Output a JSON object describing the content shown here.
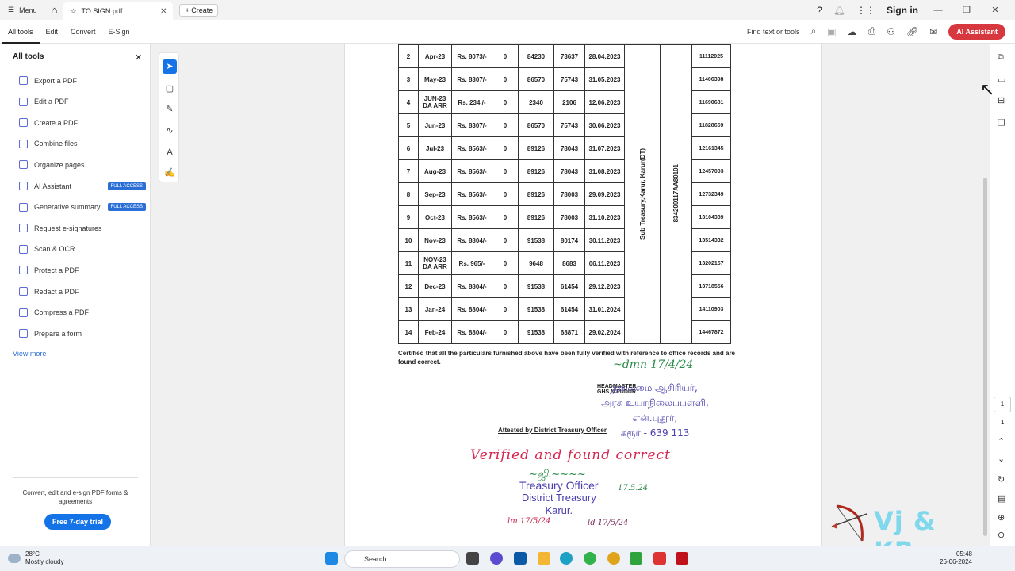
{
  "titlebar": {
    "menu_label": "Menu",
    "tab_title": "TO SIGN.pdf",
    "create_label": "Create",
    "sign_in": "Sign in"
  },
  "toolbar": {
    "tabs": [
      "All tools",
      "Edit",
      "Convert",
      "E-Sign"
    ],
    "find_label": "Find text or tools",
    "ai_assistant": "AI Assistant"
  },
  "left_panel": {
    "title": "All tools",
    "items": [
      {
        "label": "Export a PDF",
        "badge": ""
      },
      {
        "label": "Edit a PDF",
        "badge": ""
      },
      {
        "label": "Create a PDF",
        "badge": ""
      },
      {
        "label": "Combine files",
        "badge": ""
      },
      {
        "label": "Organize pages",
        "badge": ""
      },
      {
        "label": "AI Assistant",
        "badge": "FULL ACCESS"
      },
      {
        "label": "Generative summary",
        "badge": "FULL ACCESS"
      },
      {
        "label": "Request e-signatures",
        "badge": ""
      },
      {
        "label": "Scan & OCR",
        "badge": ""
      },
      {
        "label": "Protect a PDF",
        "badge": ""
      },
      {
        "label": "Redact a PDF",
        "badge": ""
      },
      {
        "label": "Compress a PDF",
        "badge": ""
      },
      {
        "label": "Prepare a form",
        "badge": ""
      }
    ],
    "view_more": "View more",
    "promo": "Convert, edit and e-sign PDF forms & agreements",
    "trial": "Free 7-day trial"
  },
  "document": {
    "rows": [
      [
        "2",
        "Apr-23",
        "Rs. 8073/-",
        "0",
        "84230",
        "73637",
        "28.04.2023",
        "11112025"
      ],
      [
        "3",
        "May-23",
        "Rs. 8307/-",
        "0",
        "86570",
        "75743",
        "31.05.2023",
        "11406398"
      ],
      [
        "4",
        "JUN-23 DA ARR",
        "Rs. 234 /-",
        "0",
        "2340",
        "2106",
        "12.06.2023",
        "11690681"
      ],
      [
        "5",
        "Jun-23",
        "Rs. 8307/-",
        "0",
        "86570",
        "75743",
        "30.06.2023",
        "11828659"
      ],
      [
        "6",
        "Jul-23",
        "Rs. 8563/-",
        "0",
        "89126",
        "78043",
        "31.07.2023",
        "12161345"
      ],
      [
        "7",
        "Aug-23",
        "Rs. 8563/-",
        "0",
        "89126",
        "78043",
        "31.08.2023",
        "12457003"
      ],
      [
        "8",
        "Sep-23",
        "Rs. 8563/-",
        "0",
        "89126",
        "78003",
        "29.09.2023",
        "12732349"
      ],
      [
        "9",
        "Oct-23",
        "Rs. 8563/-",
        "0",
        "89126",
        "78003",
        "31.10.2023",
        "13104389"
      ],
      [
        "10",
        "Nov-23",
        "Rs. 8804/-",
        "0",
        "91538",
        "80174",
        "30.11.2023",
        "13514332"
      ],
      [
        "11",
        "NOV-23 DA ARR",
        "Rs. 965/-",
        "0",
        "9648",
        "8683",
        "06.11.2023",
        "13202157"
      ],
      [
        "12",
        "Dec-23",
        "Rs. 8804/-",
        "0",
        "91538",
        "61454",
        "29.12.2023",
        "13718556"
      ],
      [
        "13",
        "Jan-24",
        "Rs. 8804/-",
        "0",
        "91538",
        "61454",
        "31.01.2024",
        "14110903"
      ],
      [
        "14",
        "Feb-24",
        "Rs. 8804/-",
        "0",
        "91538",
        "68871",
        "29.02.2024",
        "14467872"
      ]
    ],
    "treasury_vertical": "Sub Treasury,Karur, Karur(DT)",
    "account_vertical": "834200117AA80101",
    "certification": "Certified that all the particulars furnished above have been fully verified with reference to office records and are found correct.",
    "hm_line1": "HEADMASTER",
    "hm_line2": "GHS,N.PUDUR",
    "stamp_ta_1": "தலைமை ஆசிரியர்,",
    "stamp_ta_2": "அரசு உயர்நிலைப்பள்ளி,",
    "stamp_ta_3": "என்.புதூர்,",
    "stamp_ta_4": "கரூர் - 639 113",
    "attested": "Attested by District Treasury Officer",
    "verified_note": "Verified and found correct",
    "to_stamp_1": "Treasury Officer",
    "to_stamp_2": "District Treasury",
    "to_stamp_3": "Karur.",
    "sig_date": "17.5.24"
  },
  "watermark": "Vj & KR",
  "page_nav": {
    "current": "1",
    "total": "1"
  },
  "taskbar": {
    "temp": "28°C",
    "weather": "Mostly cloudy",
    "search": "Search",
    "time": "05:48",
    "date": "26-06-2024"
  },
  "colors": {
    "accent": "#1473e6",
    "ai": "#d7373f",
    "stamp": "#4a3fae",
    "ink_red": "#d6254d"
  }
}
